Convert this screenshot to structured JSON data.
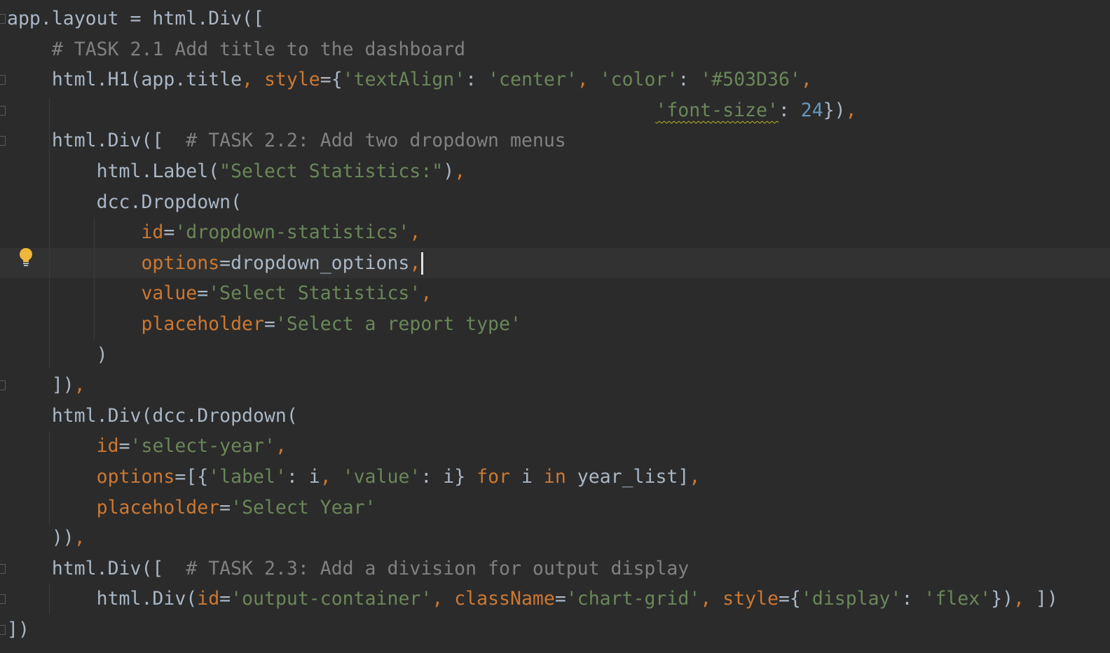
{
  "editor": {
    "lines": [
      [
        {
          "t": "app.layout = html.Div([",
          "c": "plain"
        }
      ],
      [
        {
          "t": "    ",
          "c": "plain"
        },
        {
          "t": "# TASK 2.1 Add title to the dashboard",
          "c": "cm"
        }
      ],
      [
        {
          "t": "    html.H1(app.title",
          "c": "plain"
        },
        {
          "t": ", ",
          "c": "kw"
        },
        {
          "t": "style",
          "c": "param"
        },
        {
          "t": "={",
          "c": "plain"
        },
        {
          "t": "'textAlign'",
          "c": "str"
        },
        {
          "t": ": ",
          "c": "plain"
        },
        {
          "t": "'center'",
          "c": "str"
        },
        {
          "t": ", ",
          "c": "kw"
        },
        {
          "t": "'color'",
          "c": "str"
        },
        {
          "t": ": ",
          "c": "plain"
        },
        {
          "t": "'#503D36'",
          "c": "str"
        },
        {
          "t": ",",
          "c": "kw"
        }
      ],
      [
        {
          "t": "                                                          ",
          "c": "plain"
        },
        {
          "t": "'font-size'",
          "c": "str warn"
        },
        {
          "t": ": ",
          "c": "plain"
        },
        {
          "t": "24",
          "c": "num"
        },
        {
          "t": "})",
          "c": "plain"
        },
        {
          "t": ",",
          "c": "kw"
        }
      ],
      [
        {
          "t": "    html.Div([  ",
          "c": "plain"
        },
        {
          "t": "# TASK 2.2: Add two dropdown menus",
          "c": "cm"
        }
      ],
      [
        {
          "t": "        html.Label(",
          "c": "plain"
        },
        {
          "t": "\"Select Statistics:\"",
          "c": "str"
        },
        {
          "t": ")",
          "c": "plain"
        },
        {
          "t": ",",
          "c": "kw"
        }
      ],
      [
        {
          "t": "        dcc.Dropdown(",
          "c": "plain"
        }
      ],
      [
        {
          "t": "            ",
          "c": "plain"
        },
        {
          "t": "id",
          "c": "param"
        },
        {
          "t": "=",
          "c": "plain"
        },
        {
          "t": "'dropdown-statistics'",
          "c": "str"
        },
        {
          "t": ",",
          "c": "kw"
        }
      ],
      [
        {
          "t": "            ",
          "c": "plain"
        },
        {
          "t": "options",
          "c": "param"
        },
        {
          "t": "=dropdown_options",
          "c": "plain"
        },
        {
          "t": ",",
          "c": "kw"
        }
      ],
      [
        {
          "t": "            ",
          "c": "plain"
        },
        {
          "t": "value",
          "c": "param"
        },
        {
          "t": "=",
          "c": "plain"
        },
        {
          "t": "'Select Statistics'",
          "c": "str"
        },
        {
          "t": ",",
          "c": "kw"
        }
      ],
      [
        {
          "t": "            ",
          "c": "plain"
        },
        {
          "t": "placeholder",
          "c": "param"
        },
        {
          "t": "=",
          "c": "plain"
        },
        {
          "t": "'Select a report type'",
          "c": "str"
        }
      ],
      [
        {
          "t": "        )",
          "c": "plain"
        }
      ],
      [
        {
          "t": "    ])",
          "c": "plain"
        },
        {
          "t": ",",
          "c": "kw"
        }
      ],
      [
        {
          "t": "    html.Div(dcc.Dropdown(",
          "c": "plain"
        }
      ],
      [
        {
          "t": "        ",
          "c": "plain"
        },
        {
          "t": "id",
          "c": "param"
        },
        {
          "t": "=",
          "c": "plain"
        },
        {
          "t": "'select-year'",
          "c": "str"
        },
        {
          "t": ",",
          "c": "kw"
        }
      ],
      [
        {
          "t": "        ",
          "c": "plain"
        },
        {
          "t": "options",
          "c": "param"
        },
        {
          "t": "=[{",
          "c": "plain"
        },
        {
          "t": "'label'",
          "c": "str"
        },
        {
          "t": ": i",
          "c": "plain"
        },
        {
          "t": ", ",
          "c": "kw"
        },
        {
          "t": "'value'",
          "c": "str"
        },
        {
          "t": ": i} ",
          "c": "plain"
        },
        {
          "t": "for",
          "c": "kw"
        },
        {
          "t": " i ",
          "c": "plain"
        },
        {
          "t": "in",
          "c": "kw"
        },
        {
          "t": " year_list]",
          "c": "plain"
        },
        {
          "t": ",",
          "c": "kw"
        }
      ],
      [
        {
          "t": "        ",
          "c": "plain"
        },
        {
          "t": "placeholder",
          "c": "param"
        },
        {
          "t": "=",
          "c": "plain"
        },
        {
          "t": "'Select Year'",
          "c": "str"
        }
      ],
      [
        {
          "t": "    ))",
          "c": "plain"
        },
        {
          "t": ",",
          "c": "kw"
        }
      ],
      [
        {
          "t": "    html.Div([  ",
          "c": "plain"
        },
        {
          "t": "# TASK 2.3: Add a division for output display",
          "c": "cm"
        }
      ],
      [
        {
          "t": "        html.Div(",
          "c": "plain"
        },
        {
          "t": "id",
          "c": "param"
        },
        {
          "t": "=",
          "c": "plain"
        },
        {
          "t": "'output-container'",
          "c": "str"
        },
        {
          "t": ", ",
          "c": "kw"
        },
        {
          "t": "className",
          "c": "param"
        },
        {
          "t": "=",
          "c": "plain"
        },
        {
          "t": "'chart-grid'",
          "c": "str"
        },
        {
          "t": ", ",
          "c": "kw"
        },
        {
          "t": "style",
          "c": "param"
        },
        {
          "t": "={",
          "c": "plain"
        },
        {
          "t": "'display'",
          "c": "str"
        },
        {
          "t": ": ",
          "c": "plain"
        },
        {
          "t": "'flex'",
          "c": "str"
        },
        {
          "t": "})",
          "c": "plain"
        },
        {
          "t": ", ",
          "c": "kw"
        },
        {
          "t": "])",
          "c": "plain"
        }
      ],
      [
        {
          "t": "])",
          "c": "plain"
        }
      ]
    ],
    "current_line_index": 8,
    "caret_after_line_index": 8,
    "intention_bulb_icon": "lightbulb-icon"
  }
}
